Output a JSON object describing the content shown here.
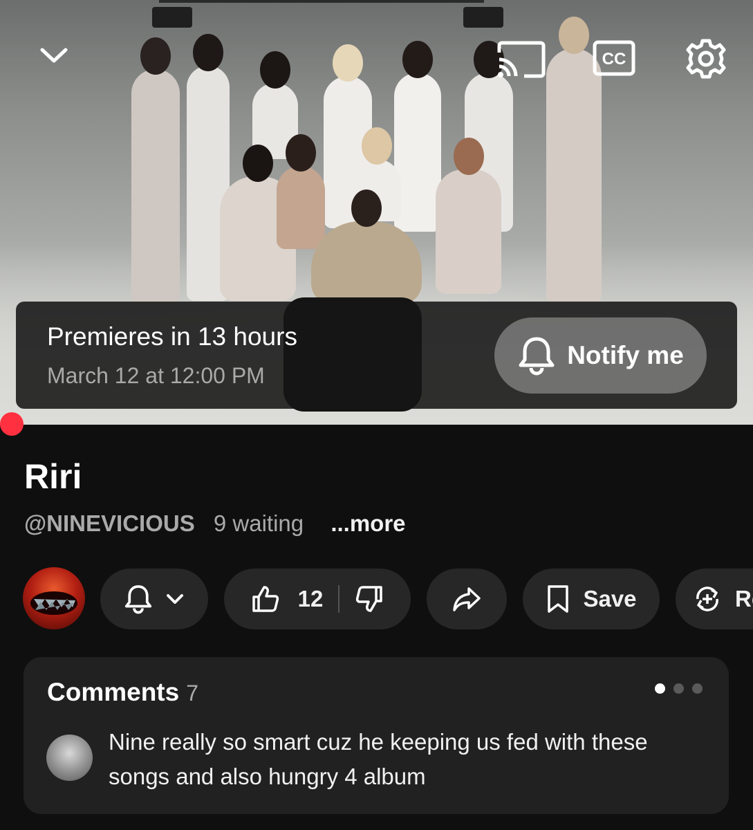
{
  "player": {
    "premiere_title": "Premieres in 13 hours",
    "premiere_date": "March 12 at 12:00 PM",
    "notify_label": "Notify me",
    "icons": [
      "chevron-down-icon",
      "cast-icon",
      "cc-icon",
      "gear-icon",
      "bell-icon"
    ]
  },
  "video": {
    "title": "Riri",
    "channel_handle": "@NINEVICIOUS",
    "waiting": "9 waiting",
    "more_label": "...more"
  },
  "actions": {
    "like_count": "12",
    "save_label": "Save",
    "remix_label": "Re"
  },
  "comments": {
    "header": "Comments",
    "count": "7",
    "first_comment": "Nine really so smart cuz he keeping us fed with these songs and also hungry 4 album"
  },
  "colors": {
    "background": "#0f0f0f",
    "pill": "#272727",
    "card": "#212121",
    "progress": "#ff3040",
    "muted_text": "#aaaaaa"
  }
}
